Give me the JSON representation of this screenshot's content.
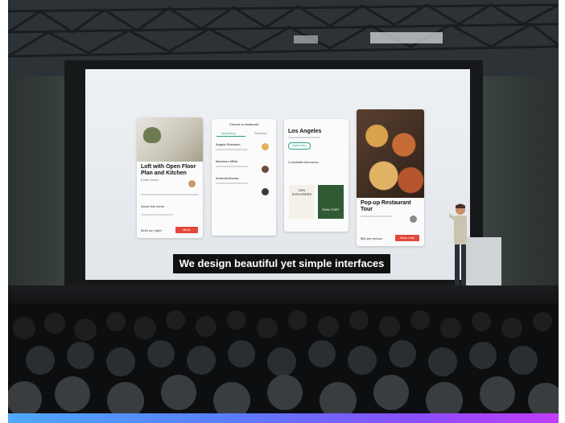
{
  "slide": {
    "caption": "We design beautiful yet simple interfaces",
    "card_room": {
      "title": "Loft with Open Floor Plan and Kitchen",
      "subtitle": "Entire home",
      "section": "About this home",
      "price": "$160 per night",
      "button": "Book"
    },
    "card_list": {
      "header": "Choose a restaurant",
      "tabs": [
        "Upcoming",
        "Previous"
      ],
      "items": [
        "Angela Robinson",
        "Marcheur Millet",
        "Amanda Brooks"
      ]
    },
    "card_city": {
      "title": "Los Angeles",
      "pill": "Add to favs",
      "section": "3 available itineraries",
      "book_a": "ZEN EXPLORERS",
      "book_b": "RAW CHEF"
    },
    "card_tour": {
      "title": "Pop-up Restaurant Tour",
      "price": "$80 per person",
      "button": "Book now"
    }
  },
  "colors": {
    "accent_red": "#e4473c",
    "gradient_start": "#4fa8ff",
    "gradient_end": "#c23cff"
  }
}
